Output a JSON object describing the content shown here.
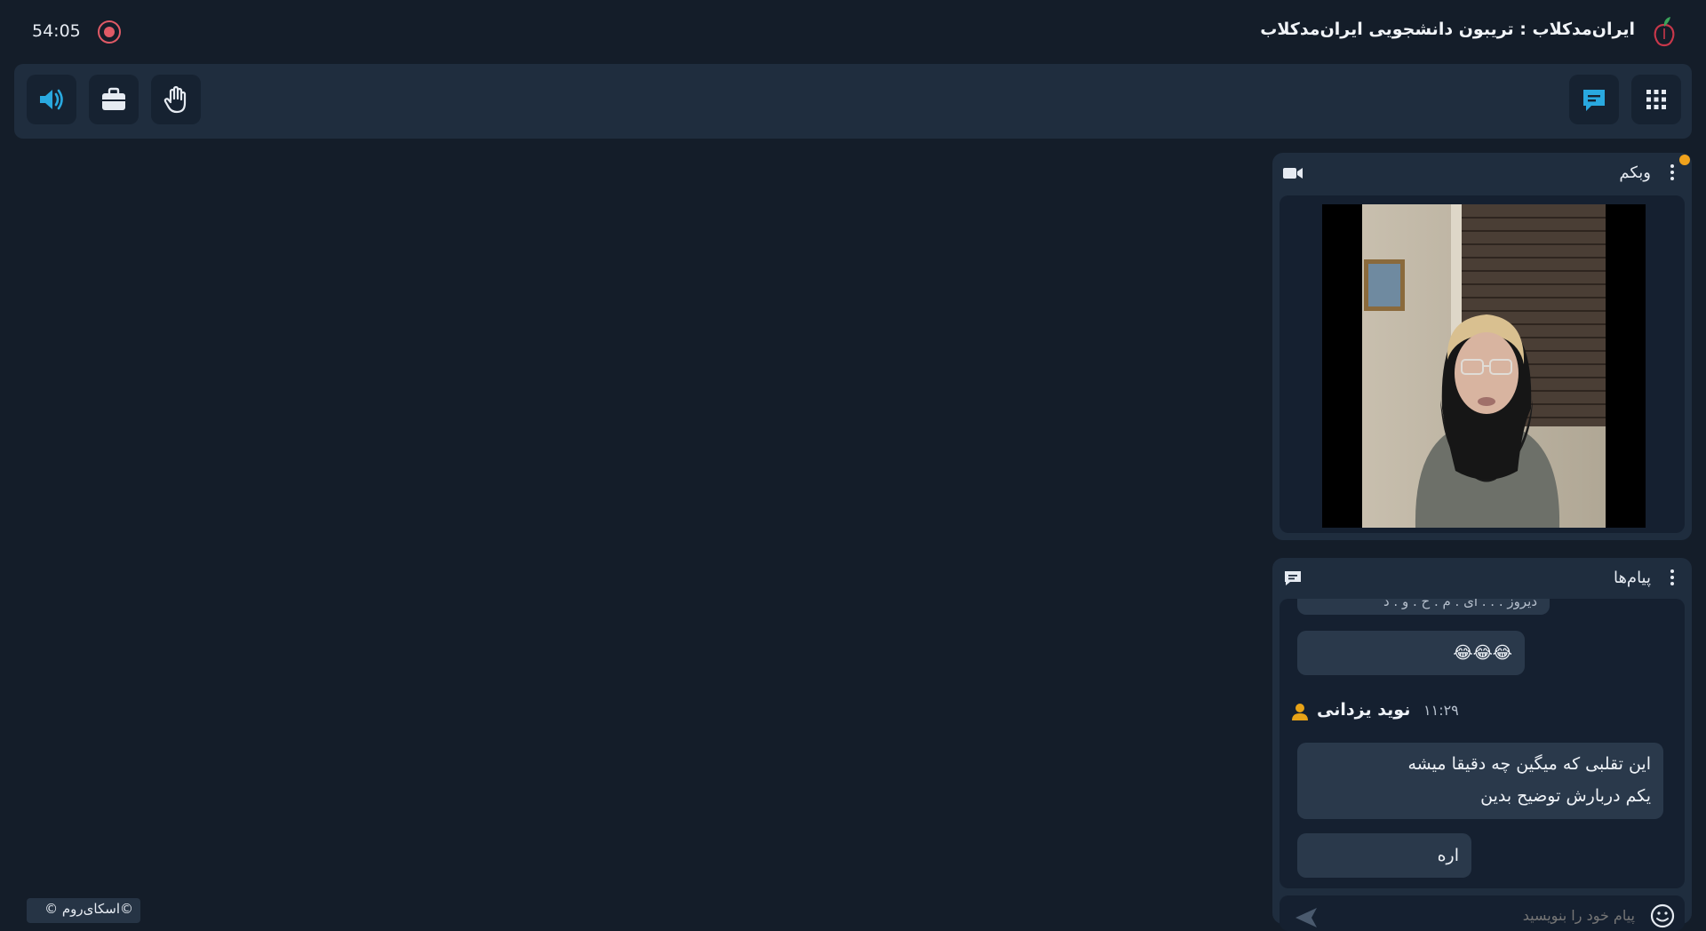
{
  "header": {
    "timer": "54:05",
    "title": "ایران‌مدکلاب : تریبون دانشجویی ایران‌مدکلاب"
  },
  "toolbar": {
    "left_buttons": [
      "speaker-icon",
      "briefcase-icon",
      "raise-hand-icon"
    ],
    "right_buttons": [
      "chat-icon",
      "apps-grid-icon"
    ]
  },
  "webcam_panel": {
    "title": "وبکم",
    "icon": "video-camera-icon"
  },
  "messages_panel": {
    "title": "پیام‌ها",
    "icon": "chat-bubble-icon",
    "partial_message": "دیروز . . . ای . م . ح . و . د",
    "emoji_message": "😂😂😂",
    "sender_name": "نوید یزدانی",
    "sender_time": "۱۱:۲۹",
    "message_line1": "این تقلبی که میگین چه دقیقا میشه",
    "message_line2": "یکم دربارش توضیح بدین",
    "short_reply": "اره",
    "input_placeholder": "پیام خود را بنویسید"
  },
  "footer": {
    "brand": "©اسکای‌روم ©"
  },
  "colors": {
    "background": "#141d29",
    "panel": "#1f2d3e",
    "accent": "#29a9e0",
    "record": "#e05a66",
    "avatar": "#e8a317"
  }
}
